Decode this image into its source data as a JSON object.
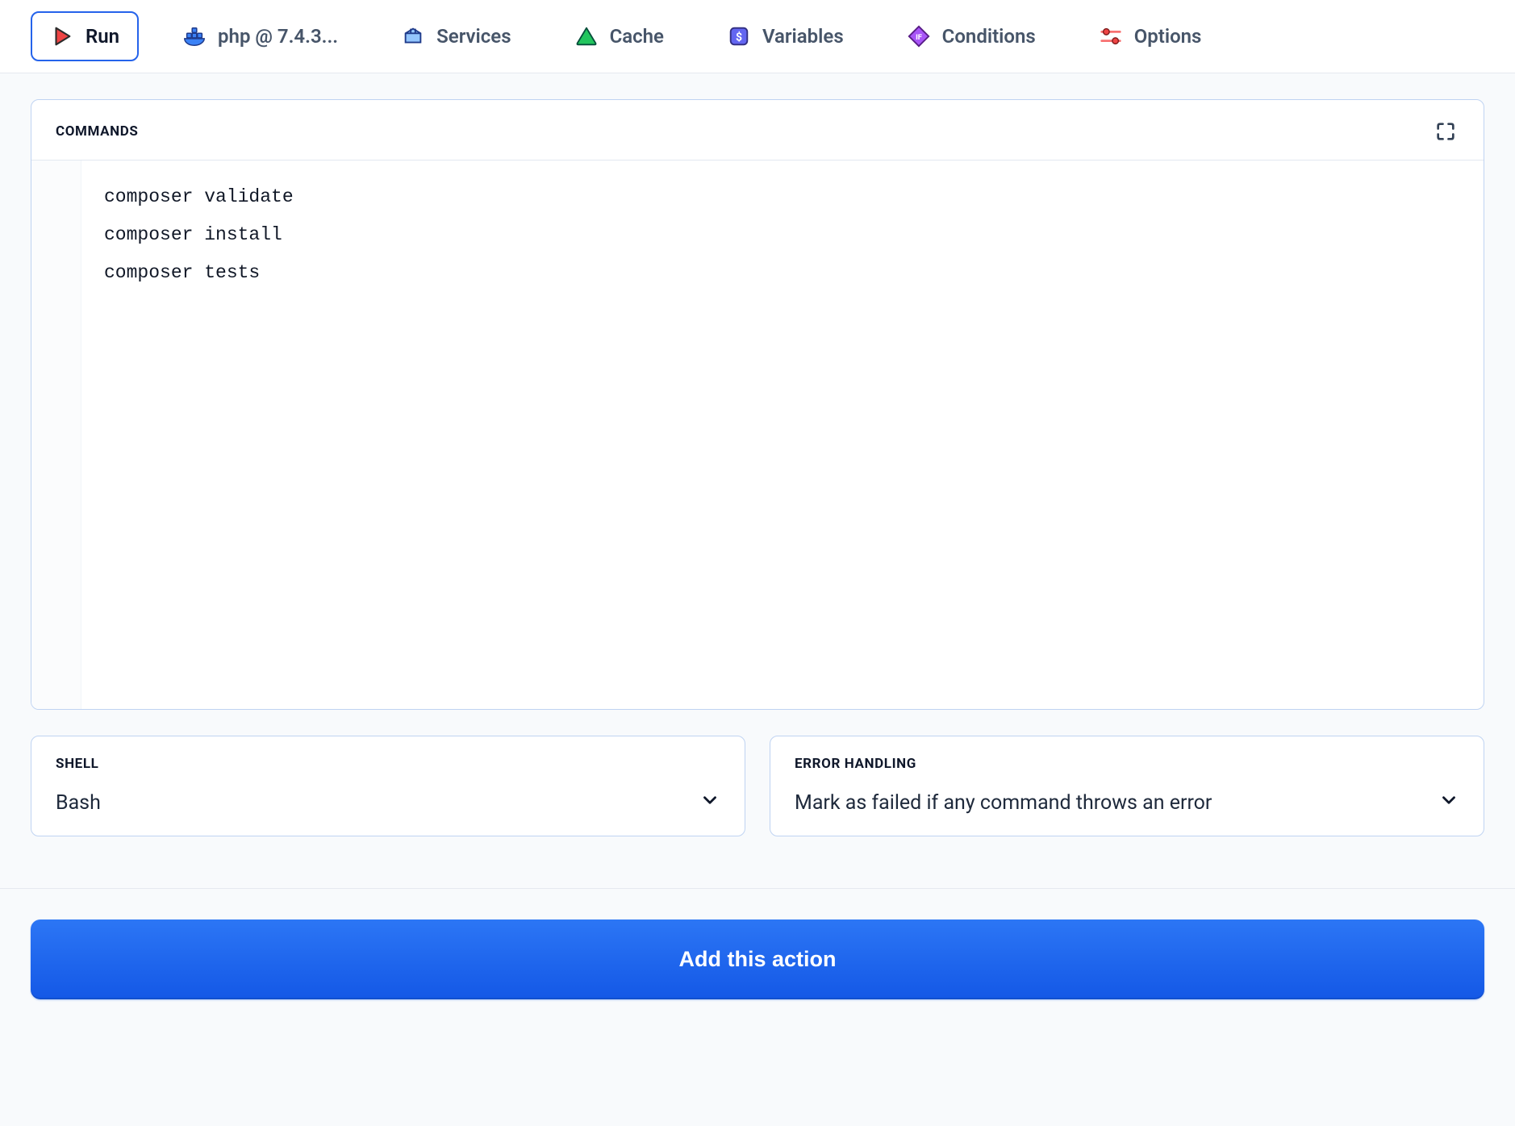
{
  "tabs": [
    {
      "label": "Run",
      "icon": "play-icon"
    },
    {
      "label": "php @ 7.4.3...",
      "icon": "docker-icon"
    },
    {
      "label": "Services",
      "icon": "package-icon"
    },
    {
      "label": "Cache",
      "icon": "triangle-icon"
    },
    {
      "label": "Variables",
      "icon": "dollar-icon"
    },
    {
      "label": "Conditions",
      "icon": "diamond-icon"
    },
    {
      "label": "Options",
      "icon": "sliders-icon"
    }
  ],
  "commands_panel": {
    "title": "COMMANDS",
    "code": "composer validate\ncomposer install\ncomposer tests"
  },
  "shell_panel": {
    "title": "SHELL",
    "value": "Bash"
  },
  "error_panel": {
    "title": "ERROR HANDLING",
    "value": "Mark as failed if any command throws an error"
  },
  "submit_button": "Add this action"
}
